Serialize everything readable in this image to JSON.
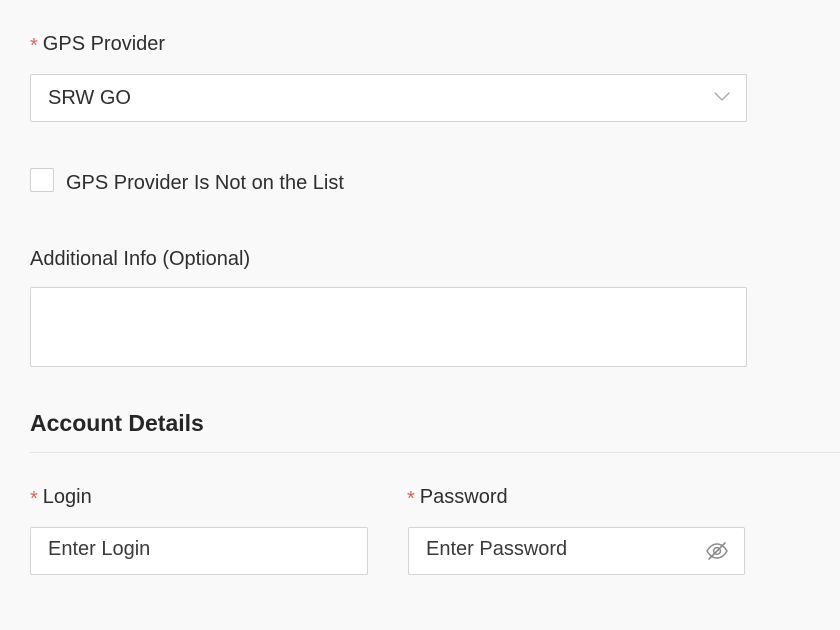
{
  "gps": {
    "label": "GPS Provider",
    "required_mark": "*",
    "selected_value": "SRW GO"
  },
  "not_listed": {
    "label": "GPS Provider Is Not on the List",
    "checked": false
  },
  "additional_info": {
    "label": "Additional Info (Optional)",
    "value": ""
  },
  "account": {
    "title": "Account Details",
    "login": {
      "label": "Login",
      "required_mark": "*",
      "placeholder": "Enter Login"
    },
    "password": {
      "label": "Password",
      "required_mark": "*",
      "placeholder": "Enter Password"
    }
  },
  "colors": {
    "background": "#f9f9f9",
    "required": "#e0605a",
    "border": "#d4d4d4",
    "text": "#2e2e2e"
  },
  "icons": {
    "dropdown": "chevron-down-icon",
    "password_toggle": "eye-off-icon"
  }
}
